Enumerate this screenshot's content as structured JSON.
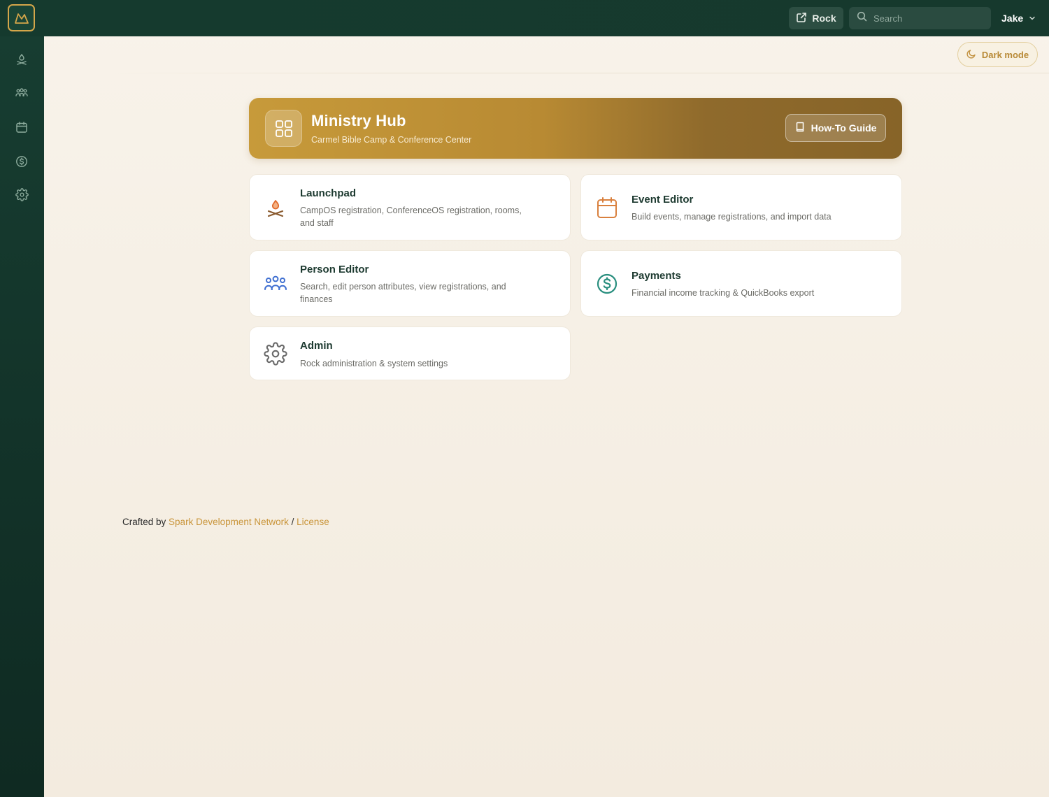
{
  "topbar": {
    "logo_icon": "mountain-logo-icon",
    "rock_label": "Rock",
    "search_placeholder": "Search",
    "user_name": "Jake"
  },
  "sidebar": {
    "items": [
      {
        "icon": "campfire-icon"
      },
      {
        "icon": "people-icon"
      },
      {
        "icon": "calendar-icon"
      },
      {
        "icon": "dollar-icon"
      },
      {
        "icon": "gear-icon"
      }
    ]
  },
  "dark_mode_label": "Dark mode",
  "hero": {
    "title": "Ministry Hub",
    "subtitle": "Carmel Bible Camp & Conference Center",
    "guide_label": "How-To Guide"
  },
  "cards": [
    {
      "title": "Launchpad",
      "description": "CampOS registration, ConferenceOS registration, rooms, and staff",
      "icon": "campfire-icon",
      "color": "#c9753a"
    },
    {
      "title": "Event Editor",
      "description": "Build events, manage registrations, and import data",
      "icon": "calendar-icon",
      "color": "#d9803e"
    },
    {
      "title": "Person Editor",
      "description": "Search, edit person attributes, view registrations, and finances",
      "icon": "people-icon",
      "color": "#3f6fd1"
    },
    {
      "title": "Payments",
      "description": "Financial income tracking & QuickBooks export",
      "icon": "dollar-icon",
      "color": "#2a8f7f"
    },
    {
      "title": "Admin",
      "description": "Rock administration & system settings",
      "icon": "gear-icon",
      "color": "#6a6a6a"
    }
  ],
  "footer": {
    "prefix": "Crafted by",
    "link1": "Spark Development Network",
    "separator": "/",
    "link2": "License"
  },
  "colors": {
    "brand_dark": "#153a2e",
    "accent_gold": "#c79a3a"
  }
}
